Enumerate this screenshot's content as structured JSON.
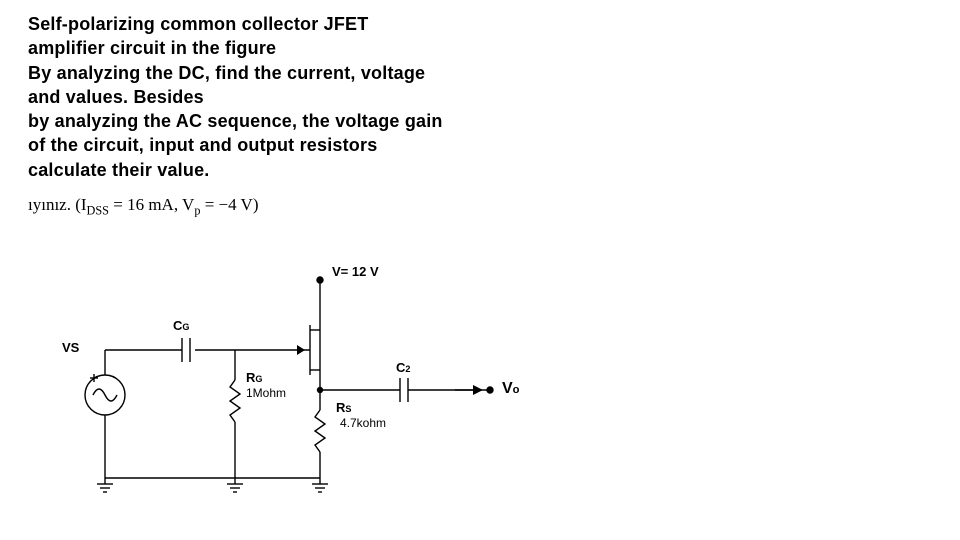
{
  "problem": {
    "l1": "Self-polarizing common collector JFET",
    "l2": "amplifier circuit in the figure",
    "l3": "By analyzing the DC, find the current, voltage",
    "l4": "and values. Besides",
    "l5": "by analyzing the AC sequence, the voltage gain",
    "l6": "of the circuit, input and output resistors",
    "l7": "calculate their value."
  },
  "params": {
    "prefix": "ıyınız. (I",
    "idss_sub": "DSS",
    "eq1": " = 16 mA, V",
    "vp_sub": "p",
    "eq2": " = −4 V)"
  },
  "circuit": {
    "supply": "V= 12 V",
    "vs": "VS",
    "cg": "C",
    "cg_sub": "G",
    "rg": "R",
    "rg_sub": "G",
    "rg_val": "1Mohm",
    "rs": "R",
    "rs_sub": "S",
    "rs_val": "4.7kohm",
    "c2": "C",
    "c2_sub": "2",
    "vo": "V",
    "vo_sub": "o"
  }
}
